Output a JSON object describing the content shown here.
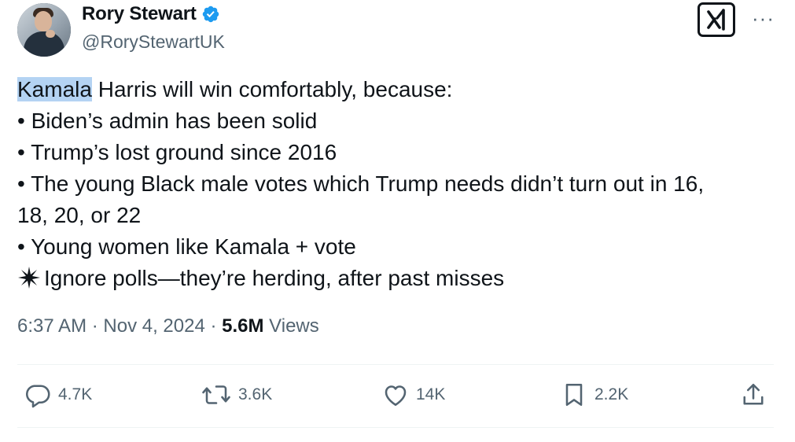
{
  "author": {
    "display_name": "Rory Stewart",
    "handle": "@RoryStewartUK",
    "verified_icon": "verified-badge-icon",
    "avatar": "profile-photo"
  },
  "header_icons": {
    "grok_icon": "grok-logo-icon",
    "more_icon": "more-options-icon",
    "more_label": "···"
  },
  "tweet": {
    "highlighted_word": "Kamala",
    "first_line_rest": " Harris will win comfortably, because:",
    "lines": [
      "• Biden’s admin has been solid",
      "• Trump’s lost ground since 2016",
      "• The young Black male votes which Trump needs didn’t turn out in 16,",
      "18, 20, or 22",
      "• Young women like Kamala + vote"
    ],
    "last_line_icon": "sparkle-icon",
    "last_line": "Ignore polls—they’re herding, after past misses"
  },
  "meta": {
    "time": "6:37 AM",
    "sep1": " · ",
    "date": "Nov 4, 2024",
    "sep2": " · ",
    "views_count": "5.6M",
    "views_label": " Views"
  },
  "actions": {
    "replies": "4.7K",
    "reposts": "3.6K",
    "likes": "14K",
    "bookmarks": "2.2K",
    "icons": [
      "reply-icon",
      "repost-icon",
      "like-icon",
      "bookmark-icon",
      "share-icon"
    ]
  },
  "colors": {
    "text": "#0f1419",
    "secondary": "#536471",
    "verified": "#1d9bf0",
    "highlight": "#b4d3f3",
    "divider": "#eff3f4"
  }
}
